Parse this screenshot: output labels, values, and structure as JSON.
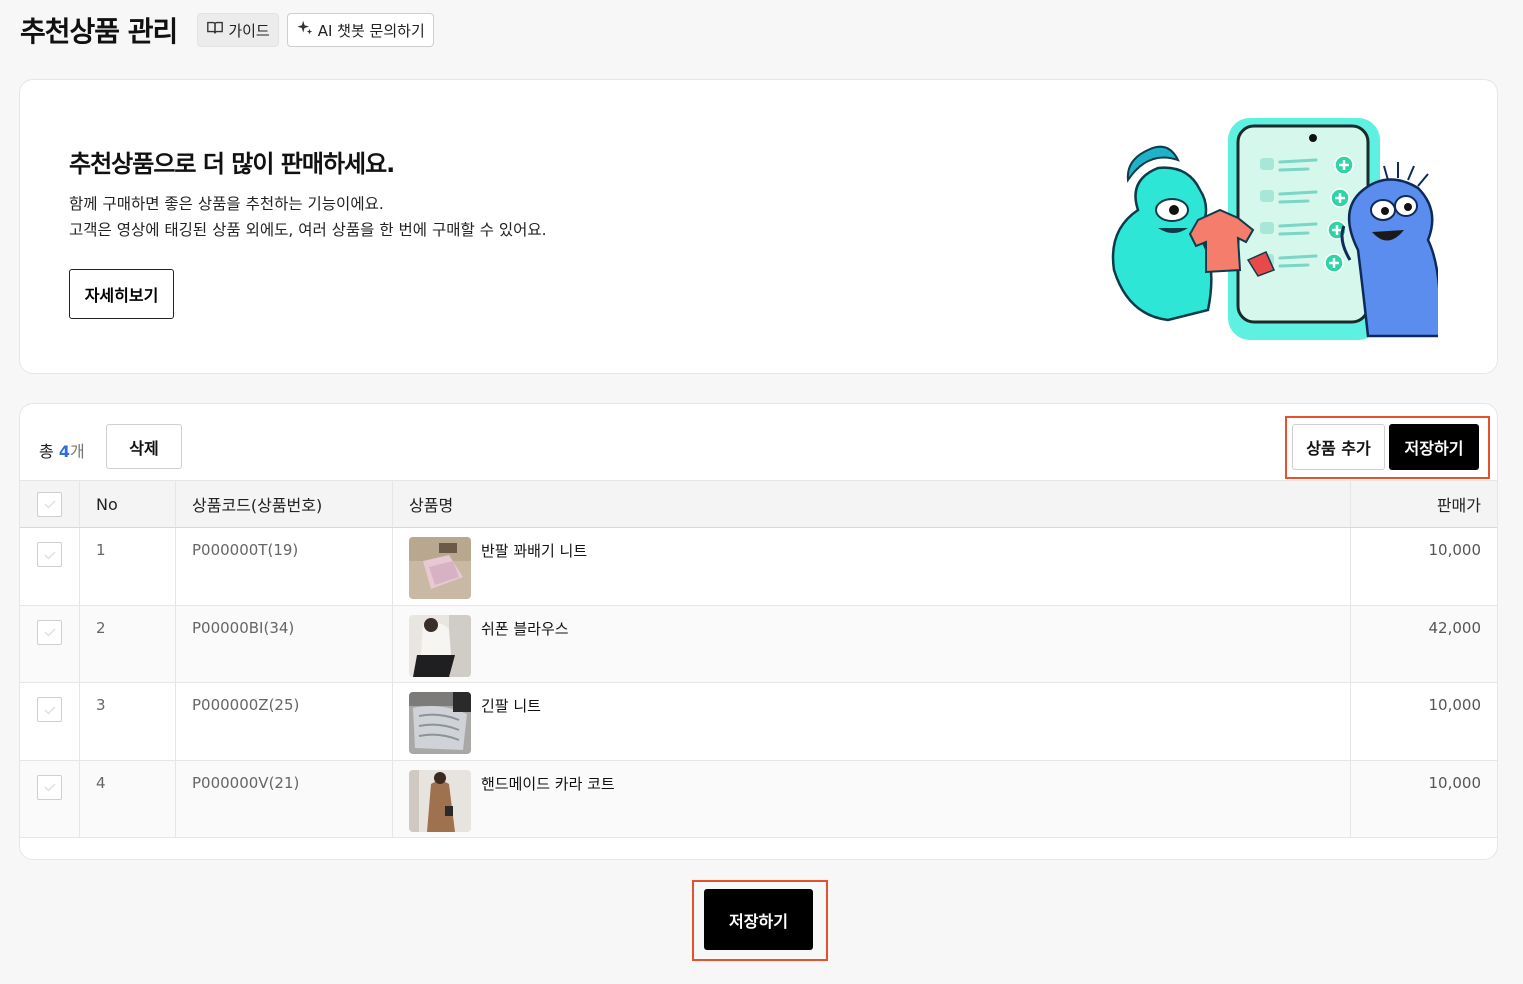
{
  "header": {
    "title": "추천상품 관리",
    "guide_label": "가이드",
    "ai_label": "AI 챗봇 문의하기"
  },
  "banner": {
    "title": "추천상품으로 더 많이 판매하세요.",
    "desc_line1": "함께 구매하면 좋은 상품을 추천하는 기능이에요.",
    "desc_line2": "고객은 영상에 태깅된 상품 외에도, 여러 상품을 한 번에 구매할 수 있어요.",
    "detail_label": "자세히보기"
  },
  "list": {
    "total_prefix": "총 ",
    "total_count": "4",
    "total_unit": "개",
    "delete_label": "삭제",
    "add_label": "상품 추가",
    "save_label": "저장하기",
    "columns": {
      "no": "No",
      "code": "상품코드(상품번호)",
      "name": "상품명",
      "price": "판매가"
    },
    "rows": [
      {
        "no": "1",
        "code": "P000000T(19)",
        "name": "반팔 꽈배기 니트",
        "price": "10,000",
        "thumb": "knit-pink"
      },
      {
        "no": "2",
        "code": "P00000BI(34)",
        "name": "쉬폰 블라우스",
        "price": "42,000",
        "thumb": "blouse-white"
      },
      {
        "no": "3",
        "code": "P000000Z(25)",
        "name": "긴팔 니트",
        "price": "10,000",
        "thumb": "knit-gray"
      },
      {
        "no": "4",
        "code": "P000000V(21)",
        "name": "핸드메이드 카라 코트",
        "price": "10,000",
        "thumb": "coat-brown"
      }
    ]
  },
  "footer": {
    "save_label": "저장하기"
  },
  "colors": {
    "accent_red": "#e5502d",
    "count_blue": "#2f6fd8",
    "illustration_teal": "#2ee6d6",
    "illustration_blue": "#5b8dee"
  }
}
